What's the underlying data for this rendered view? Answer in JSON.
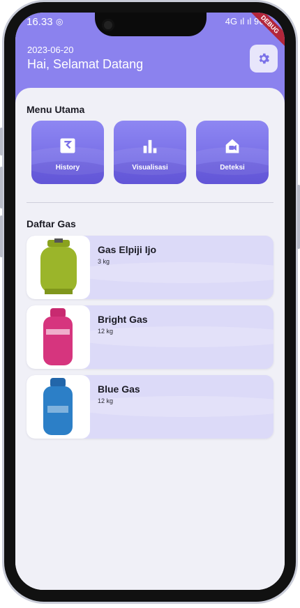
{
  "status_bar": {
    "time": "16.33",
    "indicators": "4G ıl ıl 96%"
  },
  "debug_banner": "DEBUG",
  "header": {
    "date": "2023-06-20",
    "greeting": "Hai, Selamat Datang",
    "settings_icon": "gear-icon"
  },
  "menu": {
    "title": "Menu Utama",
    "items": [
      {
        "label": "History",
        "icon": "history-icon"
      },
      {
        "label": "Visualisasi",
        "icon": "bar-chart-icon"
      },
      {
        "label": "Deteksi",
        "icon": "camera-house-icon"
      }
    ]
  },
  "gas_list": {
    "title": "Daftar Gas",
    "items": [
      {
        "name": "Gas Elpiji Ijo",
        "weight": "3 kg",
        "color": "#9bb52a"
      },
      {
        "name": "Bright Gas",
        "weight": "12 kg",
        "color": "#d6357e"
      },
      {
        "name": "Blue Gas",
        "weight": "12 kg",
        "color": "#2c7fc7"
      }
    ]
  },
  "colors": {
    "primary": "#8b82ee",
    "card": "#dcdaf8",
    "background": "#f0f0f7"
  }
}
